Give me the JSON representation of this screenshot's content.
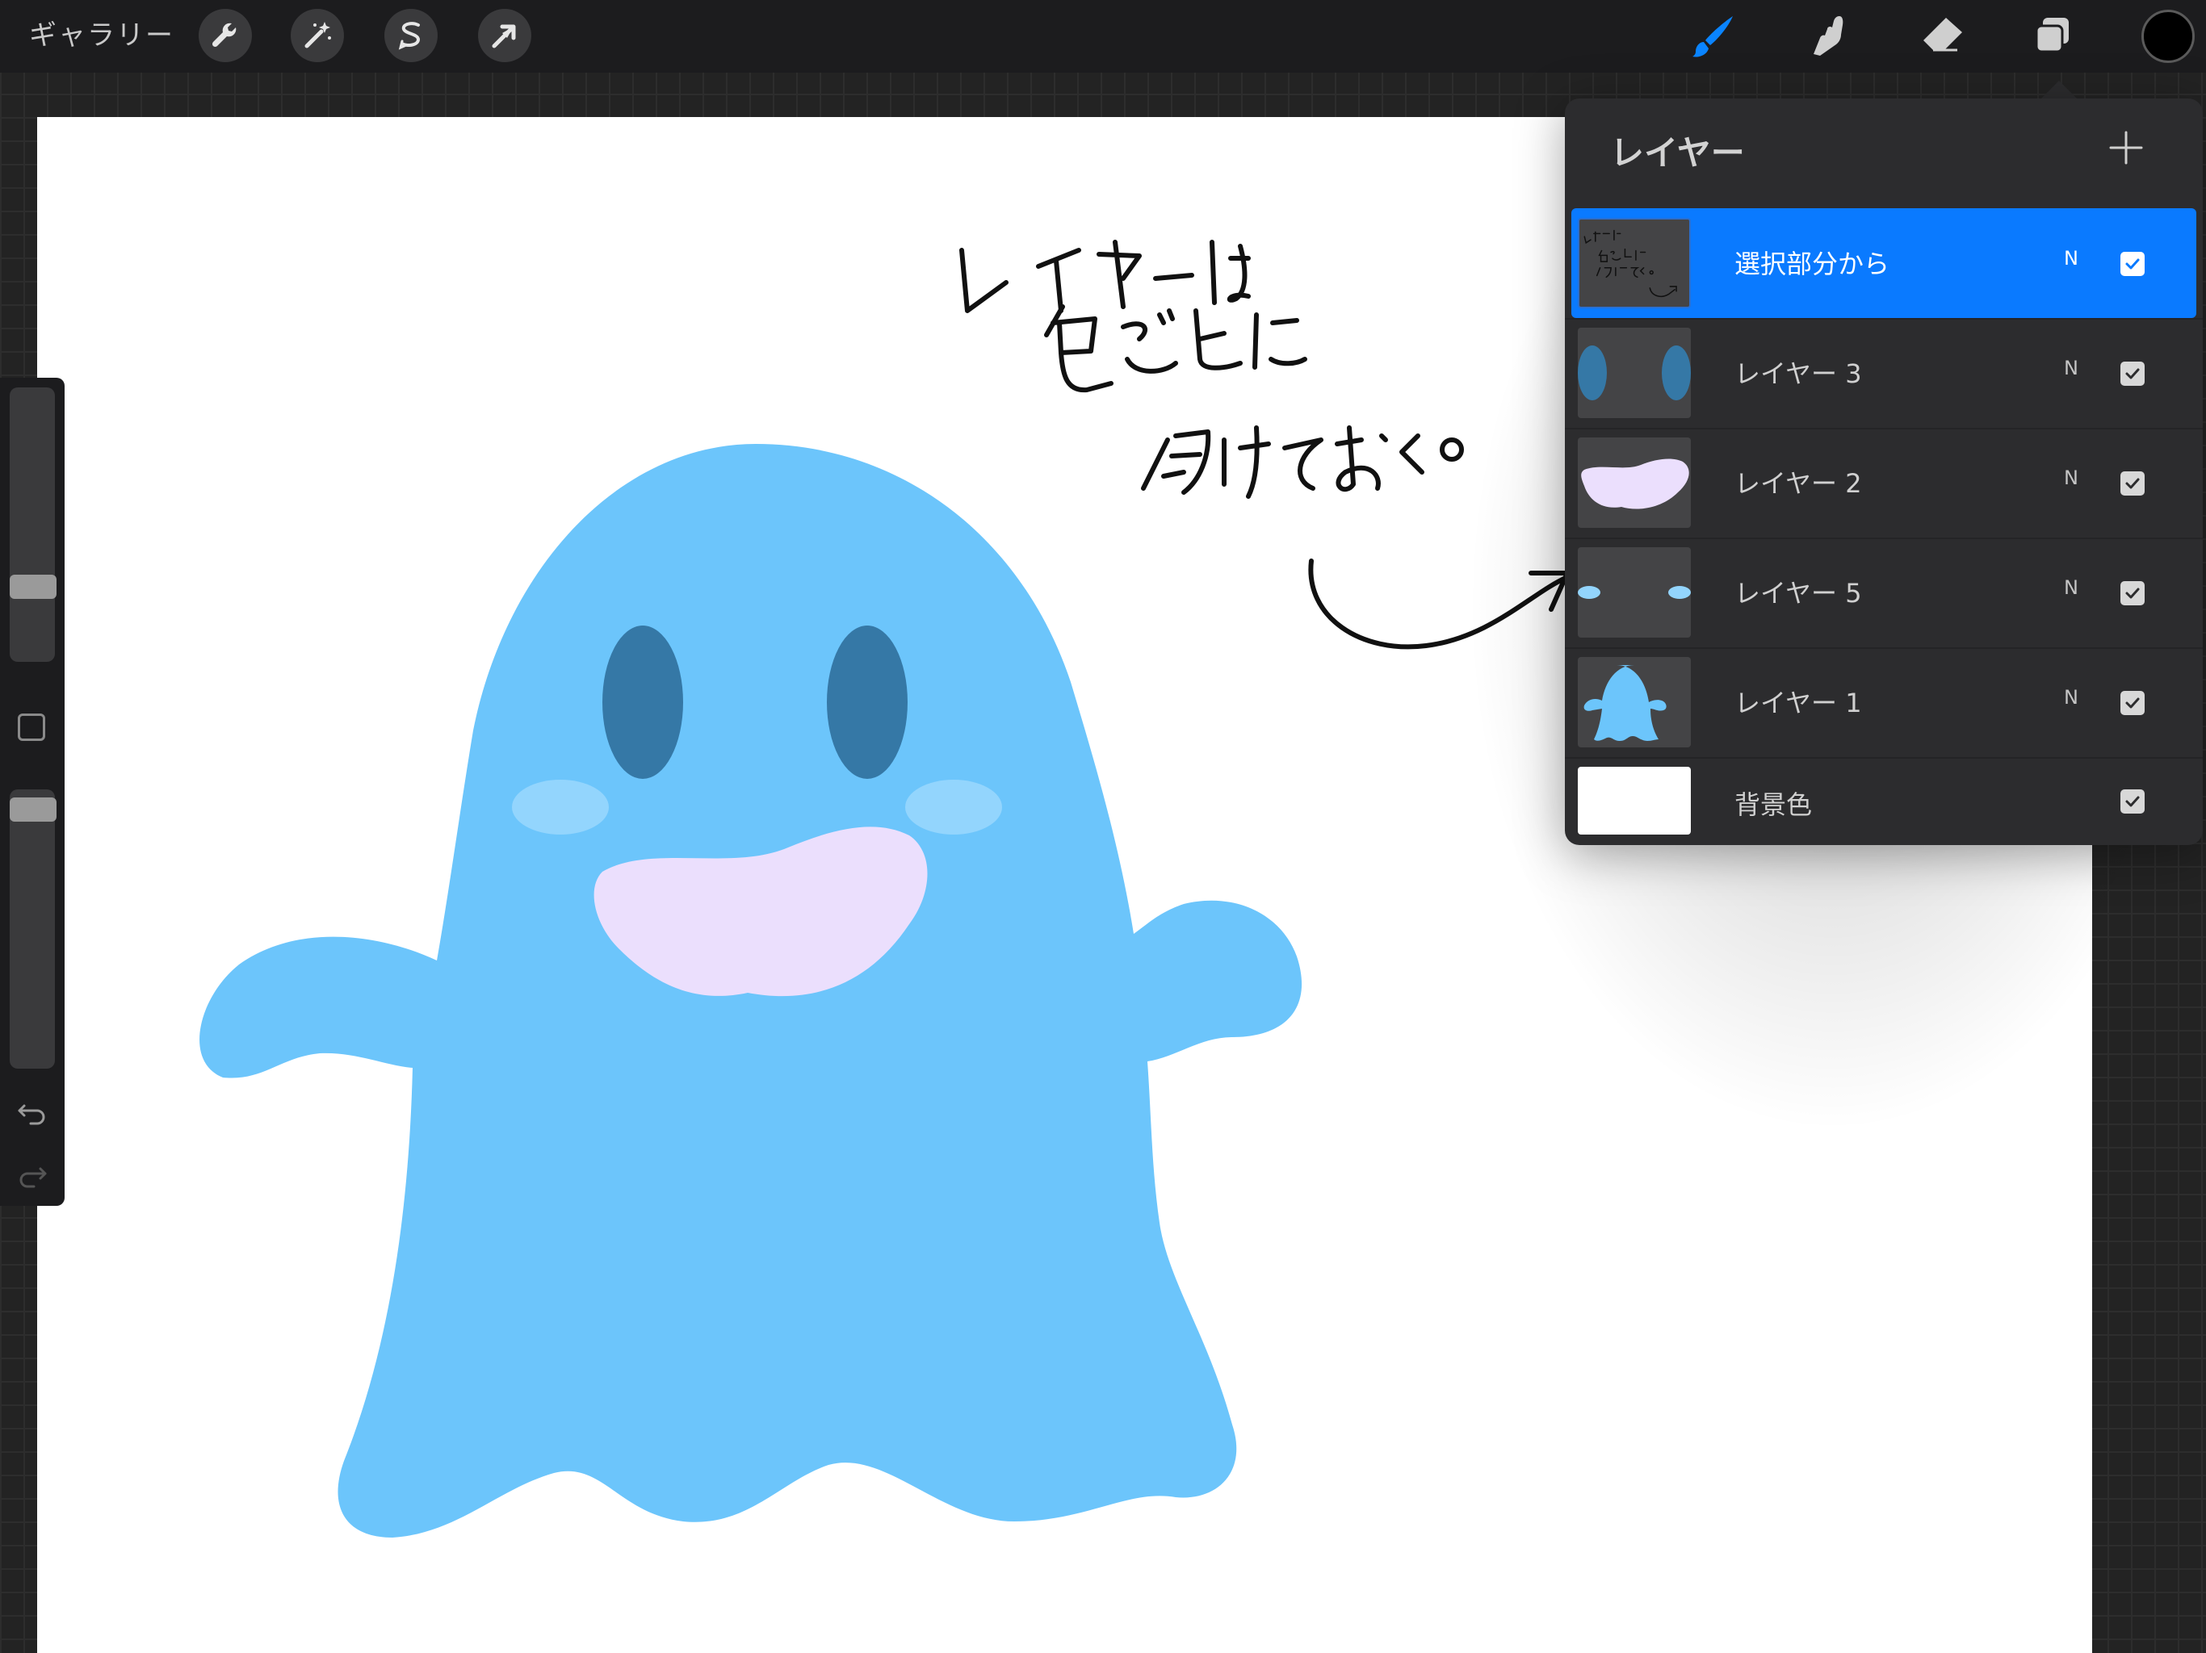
{
  "topbar": {
    "gallery_label": "ギャラリー",
    "tools_left": [
      "wrench-icon",
      "magic-wand-icon",
      "selection-icon",
      "transform-arrow-icon"
    ],
    "tools_right": [
      "brush-icon",
      "smudge-icon",
      "eraser-icon",
      "layers-icon"
    ],
    "active_tool": "brush-icon",
    "active_tool_color": "#0a84ff",
    "current_color": "#000000"
  },
  "canvas": {
    "handwritten_note": [
      "レイヤーは",
      "色ごとに",
      "分けておく。"
    ],
    "ghost_colors": {
      "body": "#6cc5fb",
      "eyes": "#3578a6",
      "cheeks": "#93d5fd",
      "mouth": "#ebdffd"
    }
  },
  "sidebar": {
    "icons": [
      "undo-icon",
      "redo-icon"
    ]
  },
  "layers_panel": {
    "title": "レイヤー",
    "add_icon": "plus-icon",
    "selected_color": "#0a7aff",
    "layers": [
      {
        "name": "選択部分から",
        "mode": "N",
        "visible": true,
        "selected": true
      },
      {
        "name": "レイヤー 3",
        "mode": "N",
        "visible": true,
        "selected": false
      },
      {
        "name": "レイヤー 2",
        "mode": "N",
        "visible": true,
        "selected": false
      },
      {
        "name": "レイヤー 5",
        "mode": "N",
        "visible": true,
        "selected": false
      },
      {
        "name": "レイヤー 1",
        "mode": "N",
        "visible": true,
        "selected": false
      },
      {
        "name": "背景色",
        "mode": "",
        "visible": true,
        "selected": false
      }
    ]
  }
}
